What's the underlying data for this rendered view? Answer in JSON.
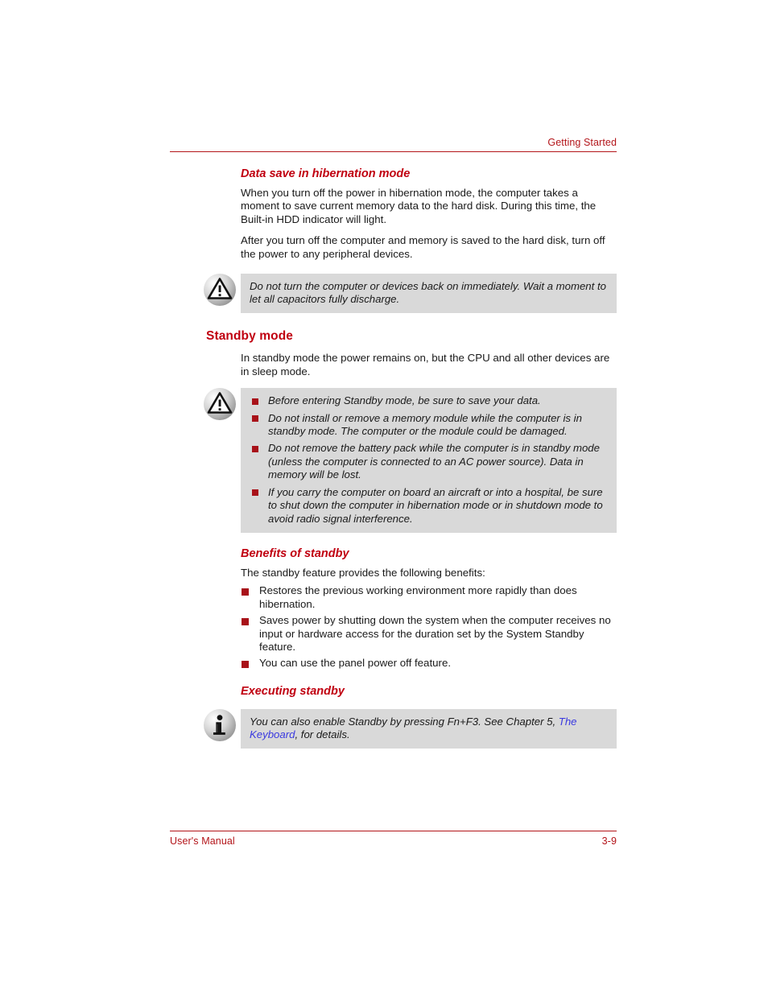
{
  "header": {
    "title": "Getting Started"
  },
  "sections": {
    "hibernation": {
      "heading": "Data save in hibernation mode",
      "paragraph1": "When you turn off the power in hibernation mode, the computer takes a moment to save current memory data to the hard disk. During this time, the Built-in HDD indicator will light.",
      "paragraph2": "After you turn off the computer and memory is saved to the hard disk, turn off the power to any peripheral devices.",
      "caution": {
        "icon": "caution-triangle-icon",
        "text": "Do not turn the computer or devices back on immediately. Wait a moment to let all capacitors fully discharge."
      }
    },
    "standby": {
      "heading": "Standby mode",
      "paragraph1": "In standby mode the power remains on, but the CPU and all other devices are in sleep mode.",
      "caution": {
        "icon": "caution-triangle-icon",
        "items": [
          "Before entering Standby mode, be sure to save your data.",
          "Do not install or remove a memory module while the computer is in standby mode. The computer or the module could be damaged.",
          "Do not remove the battery pack while the computer is in standby mode (unless the computer is connected to an AC power source). Data in memory will be lost.",
          "If you carry the computer on board an aircraft or into a hospital, be sure to shut down the computer in hibernation mode or in shutdown mode to avoid radio signal interference."
        ]
      }
    },
    "benefits": {
      "heading": "Benefits of standby",
      "intro": "The standby feature provides the following benefits:",
      "items": [
        "Restores the previous working environment more rapidly than does hibernation.",
        "Saves power by shutting down the system when the computer receives no input or hardware access for the duration set by the System Standby feature.",
        "You can use the panel power off feature."
      ]
    },
    "executing": {
      "heading": "Executing standby",
      "note": {
        "icon": "info-icon",
        "text_before": "You can also enable Standby by pressing Fn+F3. See Chapter 5, ",
        "link_text": "The Keyboard",
        "text_after": ", for details."
      }
    }
  },
  "footer": {
    "manual_label": "User's Manual",
    "page_number": "3-9"
  },
  "colors": {
    "heading_red": "#c00010",
    "rule_red": "#b3151a",
    "bullet_red": "#a81219",
    "note_bg": "#d9d9d9",
    "link_blue": "#3a39e0"
  }
}
